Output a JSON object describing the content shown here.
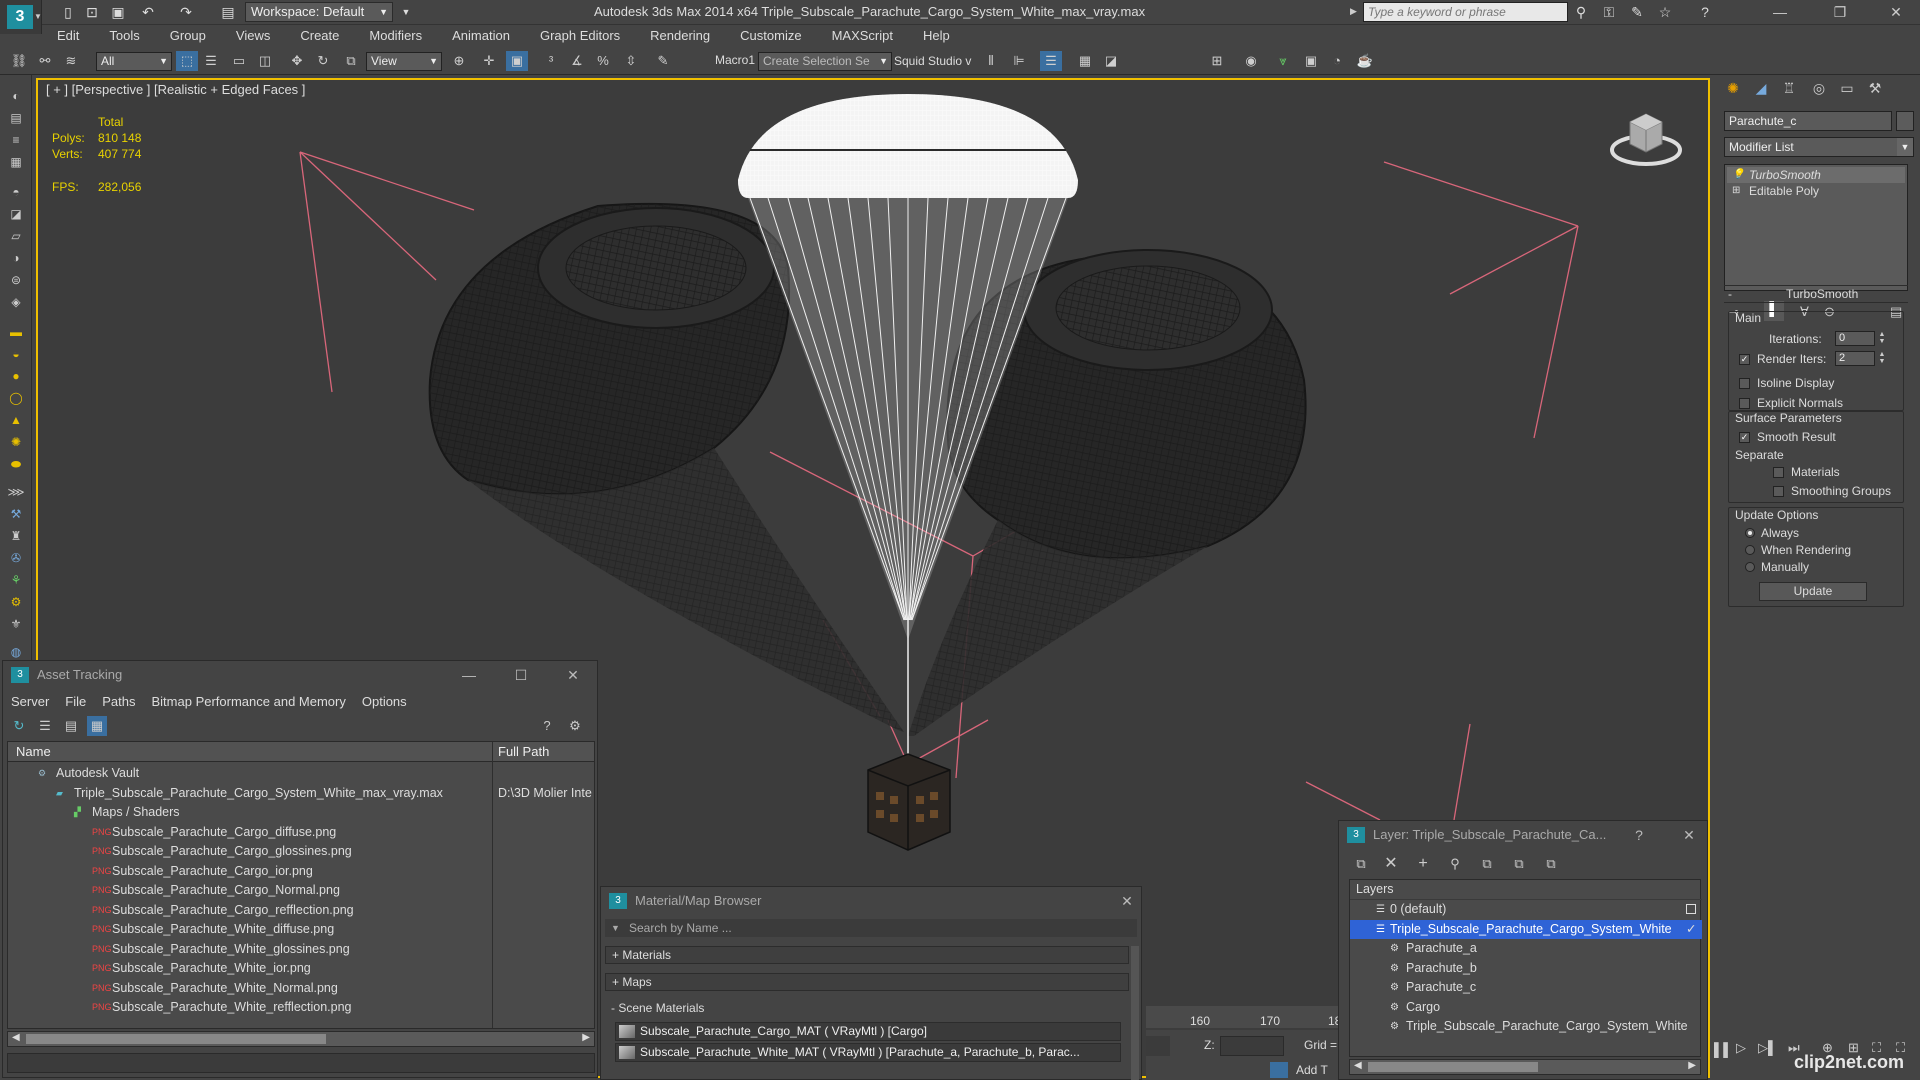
{
  "title_bar": {
    "workspace": "Workspace: Default",
    "app_title": "Autodesk 3ds Max  2014 x64     Triple_Subscale_Parachute_Cargo_System_White_max_vray.max",
    "search_placeholder": "Type a keyword or phrase"
  },
  "menu": [
    "Edit",
    "Tools",
    "Group",
    "Views",
    "Create",
    "Modifiers",
    "Animation",
    "Graph Editors",
    "Rendering",
    "Customize",
    "MAXScript",
    "Help"
  ],
  "toolbar": {
    "filter": "All",
    "ref_coord": "View",
    "macro": "Macro1",
    "selection_set": "Create Selection Se",
    "squid": "Squid Studio v"
  },
  "viewport": {
    "label": "[ + ] [Perspective ] [Realistic + Edged Faces ]",
    "stats": {
      "total_label": "Total",
      "polys_label": "Polys:",
      "polys": "810 148",
      "verts_label": "Verts:",
      "verts": "407 774",
      "fps_label": "FPS:",
      "fps": "282,056"
    }
  },
  "command_panel": {
    "object_name": "Parachute_c",
    "modifier_list": "Modifier List",
    "stack": [
      "TurboSmooth",
      "Editable Poly"
    ],
    "rollout_title": "TurboSmooth",
    "main_label": "Main",
    "iterations_label": "Iterations:",
    "iterations": "0",
    "render_iters_label": "Render Iters:",
    "render_iters": "2",
    "isoline": "Isoline Display",
    "explicit_normals": "Explicit Normals",
    "surface_params": "Surface Parameters",
    "smooth_result": "Smooth Result",
    "separate": "Separate",
    "materials": "Materials",
    "smoothing_groups": "Smoothing Groups",
    "update_options": "Update Options",
    "always": "Always",
    "when_rendering": "When Rendering",
    "manually": "Manually",
    "update_btn": "Update"
  },
  "asset_tracking": {
    "title": "Asset Tracking",
    "menu": [
      "Server",
      "File",
      "Paths",
      "Bitmap Performance and Memory",
      "Options"
    ],
    "col_name": "Name",
    "col_path": "Full Path",
    "rows": [
      {
        "name": "Autodesk Vault",
        "path": ""
      },
      {
        "name": "Triple_Subscale_Parachute_Cargo_System_White_max_vray.max",
        "path": "D:\\3D Molier Inte"
      },
      {
        "name": "Maps / Shaders",
        "path": ""
      },
      {
        "name": "Subscale_Parachute_Cargo_diffuse.png",
        "path": ""
      },
      {
        "name": "Subscale_Parachute_Cargo_glossines.png",
        "path": ""
      },
      {
        "name": "Subscale_Parachute_Cargo_ior.png",
        "path": ""
      },
      {
        "name": "Subscale_Parachute_Cargo_Normal.png",
        "path": ""
      },
      {
        "name": "Subscale_Parachute_Cargo_refflection.png",
        "path": ""
      },
      {
        "name": "Subscale_Parachute_White_diffuse.png",
        "path": ""
      },
      {
        "name": "Subscale_Parachute_White_glossines.png",
        "path": ""
      },
      {
        "name": "Subscale_Parachute_White_ior.png",
        "path": ""
      },
      {
        "name": "Subscale_Parachute_White_Normal.png",
        "path": ""
      },
      {
        "name": "Subscale_Parachute_White_refflection.png",
        "path": ""
      }
    ]
  },
  "material_browser": {
    "title": "Material/Map Browser",
    "search_placeholder": "Search by Name ...",
    "sections": [
      "+ Materials",
      "+ Maps",
      "- Scene Materials"
    ],
    "items": [
      "Subscale_Parachute_Cargo_MAT  ( VRayMtl )  [Cargo]",
      "Subscale_Parachute_White_MAT  ( VRayMtl )  [Parachute_a, Parachute_b, Parac..."
    ]
  },
  "layer_window": {
    "title": "Layer: Triple_Subscale_Parachute_Ca...",
    "help": "?",
    "header": "Layers",
    "rows": [
      {
        "name": "0 (default)",
        "indent": 0,
        "selected": false
      },
      {
        "name": "Triple_Subscale_Parachute_Cargo_System_White",
        "indent": 0,
        "selected": true
      },
      {
        "name": "Parachute_a",
        "indent": 1,
        "selected": false
      },
      {
        "name": "Parachute_b",
        "indent": 1,
        "selected": false
      },
      {
        "name": "Parachute_c",
        "indent": 1,
        "selected": false
      },
      {
        "name": "Cargo",
        "indent": 1,
        "selected": false
      },
      {
        "name": "Triple_Subscale_Parachute_Cargo_System_White",
        "indent": 1,
        "selected": false
      }
    ]
  },
  "timeline": {
    "ticks": [
      "160",
      "170",
      "18"
    ]
  },
  "status": {
    "z_label": "Z:",
    "grid_label": "Grid =",
    "add_t": "Add T"
  },
  "watermark": "clip2net.com",
  "colors": {
    "viewport_border": "#f0c000",
    "stats": "#e8d200",
    "selection": "#3a6fd8",
    "accent": "#1f8f9f",
    "pink_lines": "#d8667a"
  }
}
